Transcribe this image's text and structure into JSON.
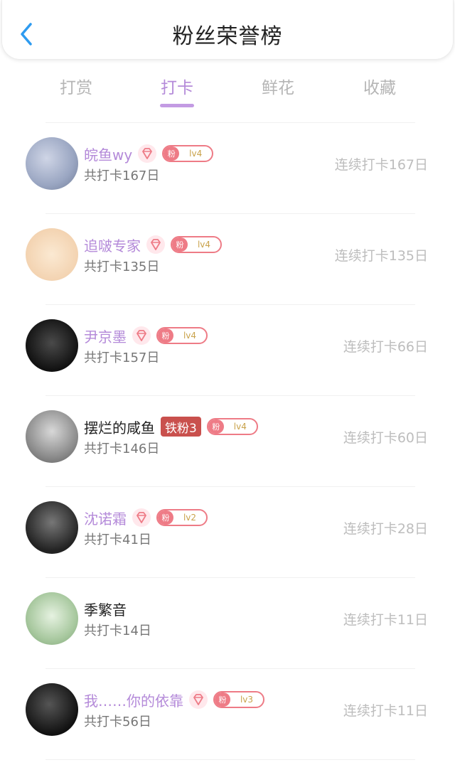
{
  "header": {
    "title": "粉丝荣誉榜"
  },
  "tabs": [
    {
      "label": "打赏"
    },
    {
      "label": "打卡"
    },
    {
      "label": "鲜花"
    },
    {
      "label": "收藏"
    }
  ],
  "active_tab": "打卡",
  "rows": [
    {
      "name": "皖鱼wy",
      "has_gem": true,
      "fan_tag": "粉",
      "level": "lv4",
      "total": "共打卡167日",
      "streak": "连续打卡167日"
    },
    {
      "name": "追啵专家",
      "has_gem": true,
      "fan_tag": "粉",
      "level": "lv4",
      "total": "共打卡135日",
      "streak": "连续打卡135日"
    },
    {
      "name": "尹京墨",
      "has_gem": true,
      "fan_tag": "粉",
      "level": "lv4",
      "total": "共打卡157日",
      "streak": "连续打卡66日"
    },
    {
      "name": "摆烂的咸鱼",
      "iron_badge": "铁粉3",
      "fan_tag": "粉",
      "level": "lv4",
      "total": "共打卡146日",
      "streak": "连续打卡60日"
    },
    {
      "name": "沈诺霜",
      "has_gem": true,
      "fan_tag": "粉",
      "level": "lv2",
      "total": "共打卡41日",
      "streak": "连续打卡28日"
    },
    {
      "name": "季繁音",
      "total": "共打卡14日",
      "streak": "连续打卡11日"
    },
    {
      "name": "我……你的依靠",
      "has_gem": true,
      "fan_tag": "粉",
      "level": "lv3",
      "total": "共打卡56日",
      "streak": "连续打卡11日"
    }
  ],
  "colors": {
    "accent_purple": "#b48ad9",
    "badge_red": "#ee7b86",
    "iron_badge": "#c9504d",
    "back_arrow": "#2e9bf0"
  }
}
